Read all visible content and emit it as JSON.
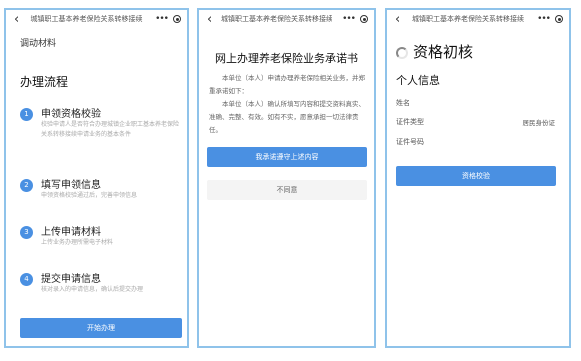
{
  "screens": [
    {
      "window_title": "城镇职工基本养老保险关系转移接续",
      "section_label": "调动材料",
      "process_title": "办理流程",
      "steps": [
        {
          "num": "1",
          "title": "申领资格校验",
          "desc": "校验申请人是否符合办理城镇企业职工基本养老保险关系转移接续申请业务的基本条件"
        },
        {
          "num": "2",
          "title": "填写申领信息",
          "desc": "申领资格校验通过后，完善申领信息"
        },
        {
          "num": "3",
          "title": "上传申请材料",
          "desc": "上传业务办理所需电子材料"
        },
        {
          "num": "4",
          "title": "提交申请信息",
          "desc": "核对录入的申请信息，确认后提交办理"
        }
      ],
      "start_button": "开始办理"
    },
    {
      "window_title": "城镇职工基本养老保险关系转移接续",
      "promise_title": "网上办理养老保险业务承诺书",
      "paragraphs": [
        "本单位（本人）申请办理养老保险相关业务，并郑重承诺如下：",
        "本单位（本人）确认所填写内容和提交资料真实、准确、完整、有效。如有不实，愿意承担一切法律责任。"
      ],
      "agree_button": "我承诺遵守上述内容",
      "disagree_button": "不同意"
    },
    {
      "window_title": "城镇职工基本养老保险关系转移接续",
      "qual_title": "资格初核",
      "info_title": "个人信息",
      "fields": [
        {
          "label": "姓名",
          "value": ""
        },
        {
          "label": "证件类型",
          "value": "居民身份证"
        },
        {
          "label": "证件号码",
          "value": ""
        }
      ],
      "verify_button": "资格校验"
    }
  ],
  "icons": [
    "back-arrow-icon",
    "more-dots-icon",
    "target-icon",
    "loading-spinner-icon"
  ],
  "colors": {
    "accent": "#4a90e2",
    "frame_border": "#8fc3ea",
    "secondary_button": "#f4f4f4"
  }
}
